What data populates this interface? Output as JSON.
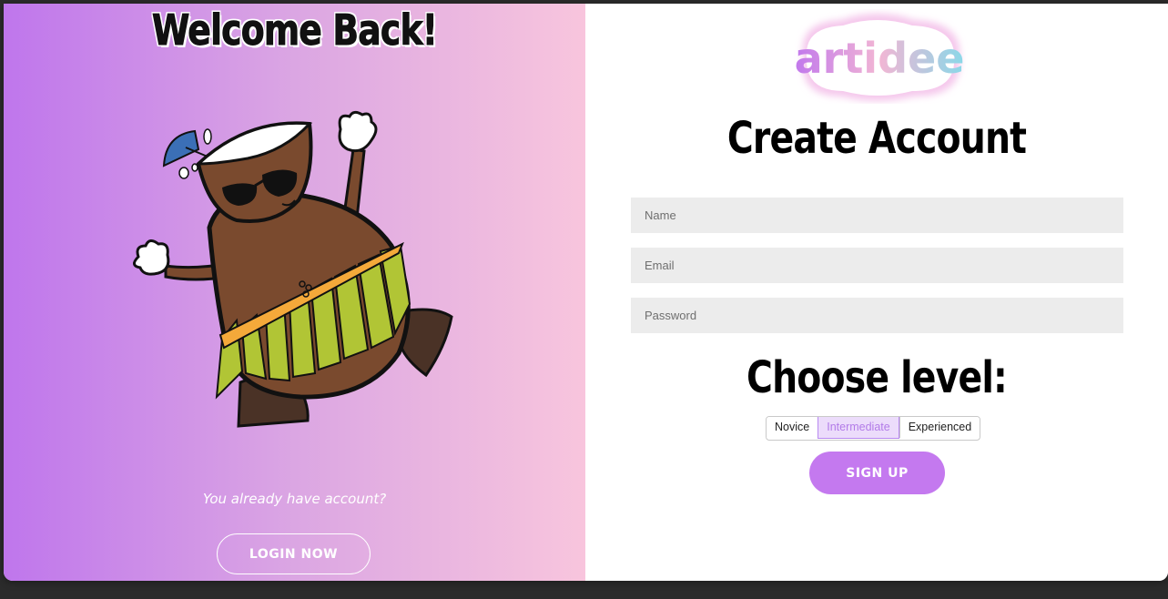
{
  "left_panel": {
    "title": "Welcome Back!",
    "prompt": "You already have account?",
    "login_button": "LOGIN NOW"
  },
  "right_panel": {
    "logo_text": "artidee",
    "title": "Create Account",
    "fields": {
      "name_placeholder": "Name",
      "email_placeholder": "Email",
      "password_placeholder": "Password"
    },
    "level_title": "Choose level:",
    "levels": [
      "Novice",
      "Intermediate",
      "Experienced"
    ],
    "selected_level": "Intermediate",
    "signup_button": "SIGN UP"
  },
  "colors": {
    "accent": "#c479ef",
    "gradient_start": "#bf76ec",
    "gradient_end": "#f8c5dd",
    "field_bg": "#ececec"
  }
}
